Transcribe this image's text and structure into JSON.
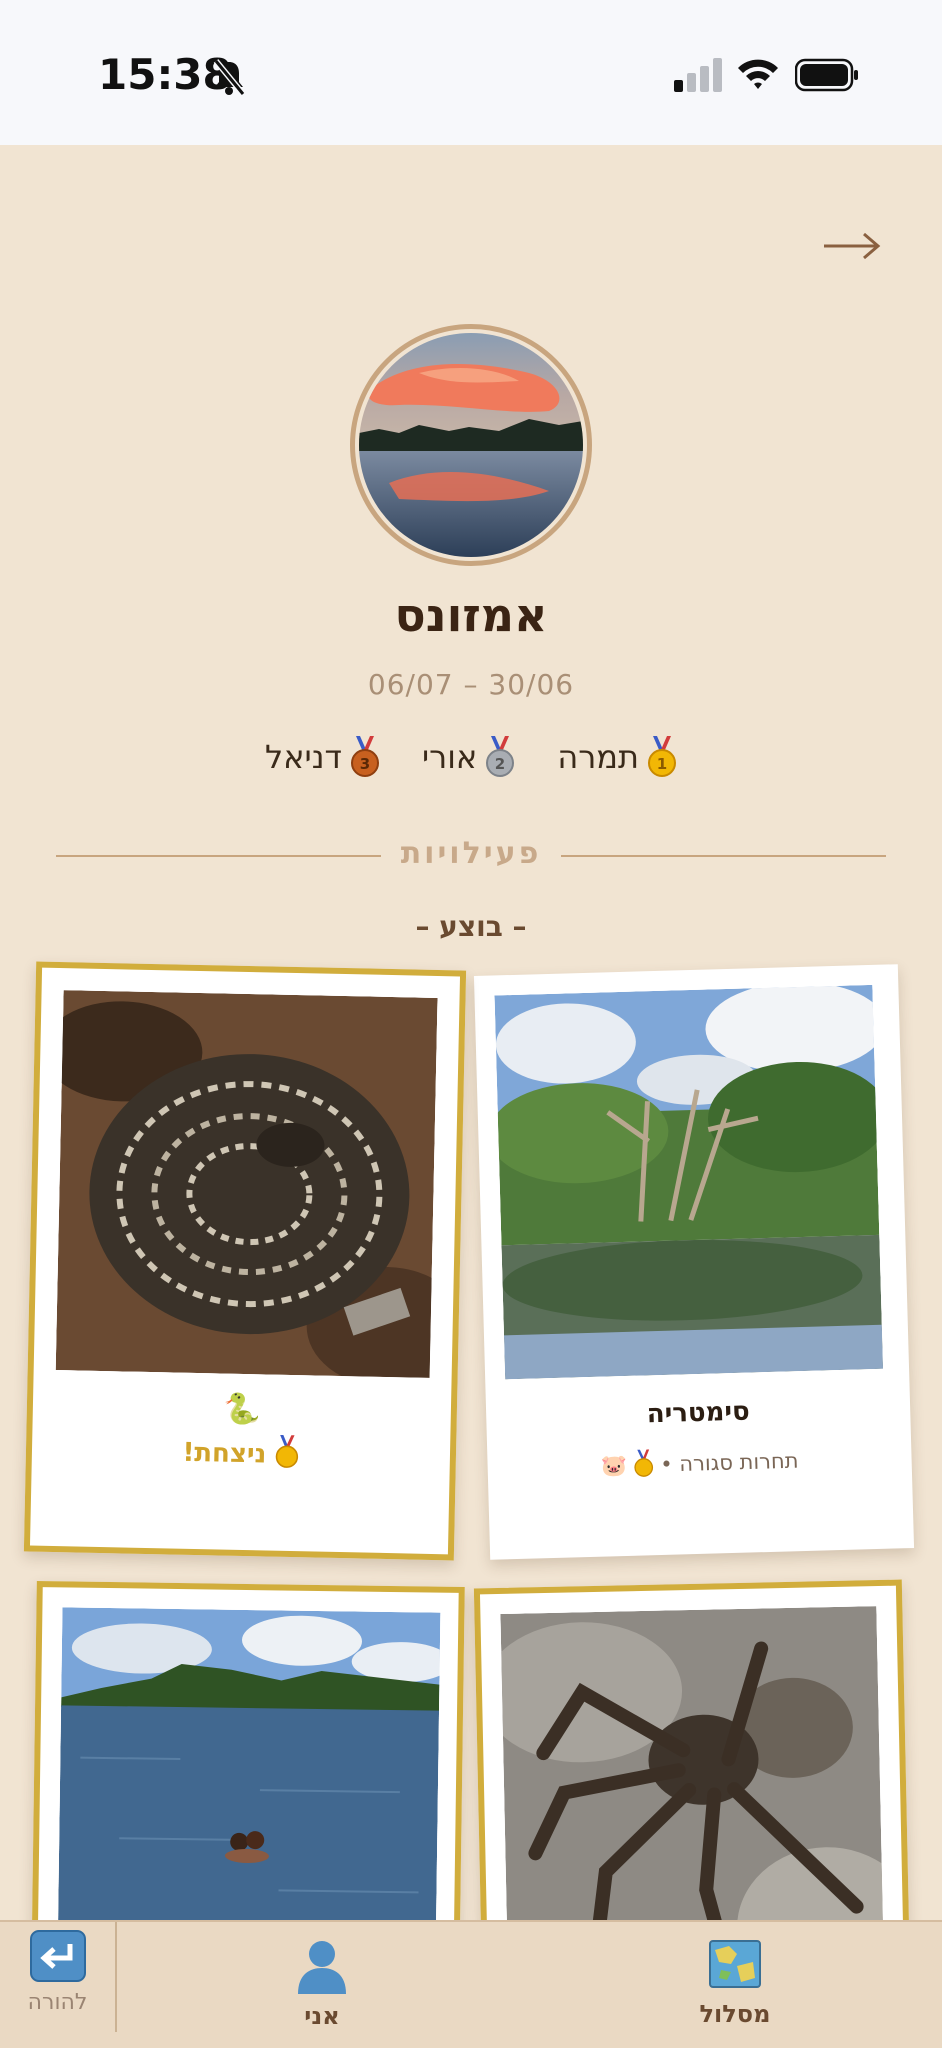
{
  "status_bar": {
    "time": "15:38",
    "icons": [
      "bell-off-icon",
      "signal-icon",
      "wifi-icon",
      "battery-icon"
    ]
  },
  "header": {
    "back_icon": "arrow-right-icon"
  },
  "trip": {
    "title": "אמזונס",
    "dates": "06/07 – 30/06",
    "ranking": [
      {
        "place": 1,
        "name": "תמרה",
        "medal": "gold-medal-icon"
      },
      {
        "place": 2,
        "name": "אורי",
        "medal": "silver-medal-icon"
      },
      {
        "place": 3,
        "name": "דניאל",
        "medal": "bronze-medal-icon"
      }
    ]
  },
  "activities": {
    "section_label": "פעילויות",
    "done_label": "– בוצע –",
    "cards": [
      {
        "title": "סימטריה",
        "subtitle": "תחרות סגורה •",
        "medal": "gold-medal-icon",
        "emoji": "🐷",
        "photo": "flooded-forest-photo"
      },
      {
        "emoji": "🐍",
        "win_text": "ניצחת!",
        "medal": "gold-medal-icon",
        "photo": "rattlesnake-photo"
      },
      {
        "photo": "tarantula-photo"
      },
      {
        "photo": "river-swim-photo"
      }
    ]
  },
  "tab_bar": {
    "tabs": [
      {
        "label": "מסלול",
        "icon": "map-icon"
      },
      {
        "label": "אני",
        "icon": "person-icon"
      },
      {
        "label": "להורה",
        "icon": "return-icon"
      }
    ]
  },
  "colors": {
    "background": "#f1e4d2",
    "gold": "#d1ad3c",
    "title": "#3b2414",
    "muted": "#a98f76"
  }
}
